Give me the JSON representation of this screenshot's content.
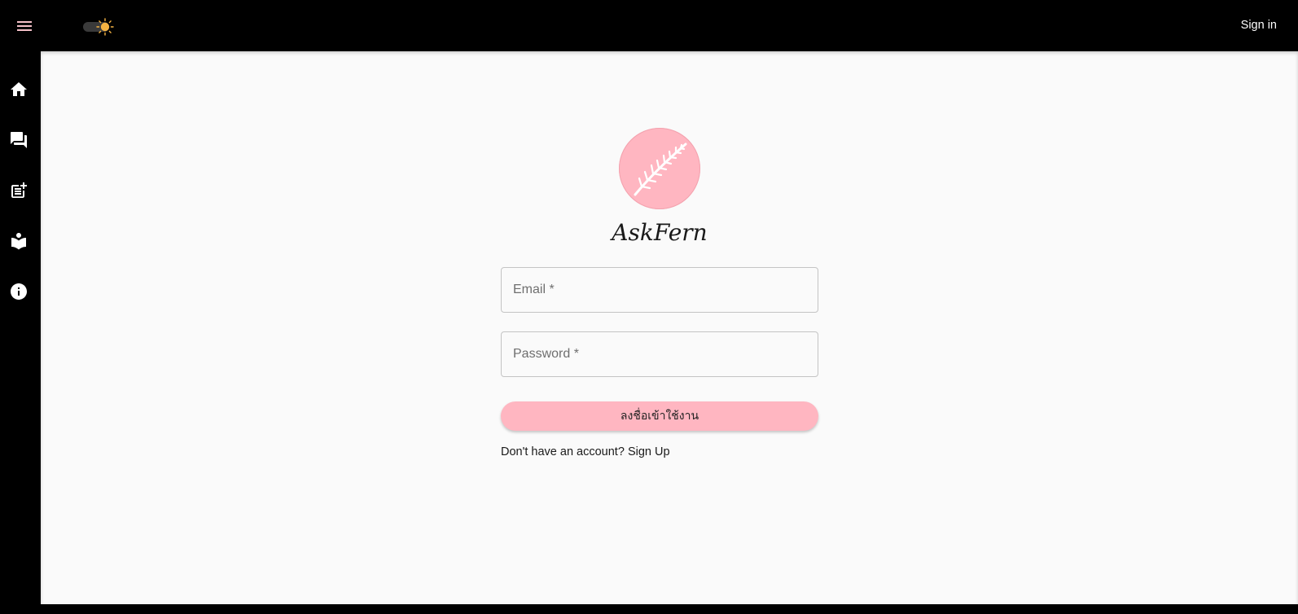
{
  "topbar": {
    "signin_label": "Sign in"
  },
  "icons": {
    "menu": "hamburger-menu-icon",
    "theme": "sun-icon",
    "nav": [
      "home-icon",
      "forum-icon",
      "post-add-icon",
      "learn-icon",
      "info-icon"
    ]
  },
  "brand": {
    "name": "AskFern",
    "circle_color": "#ffb6c1"
  },
  "form": {
    "email_placeholder": "Email *",
    "password_placeholder": "Password *",
    "submit_label": "ลงชื่อเข้าใช้งาน",
    "signup_prompt": "Don't have an account? ",
    "signup_link": "Sign Up"
  },
  "colors": {
    "accent": "#ffb6c1",
    "chrome": "#000000",
    "background": "#fafafa"
  }
}
